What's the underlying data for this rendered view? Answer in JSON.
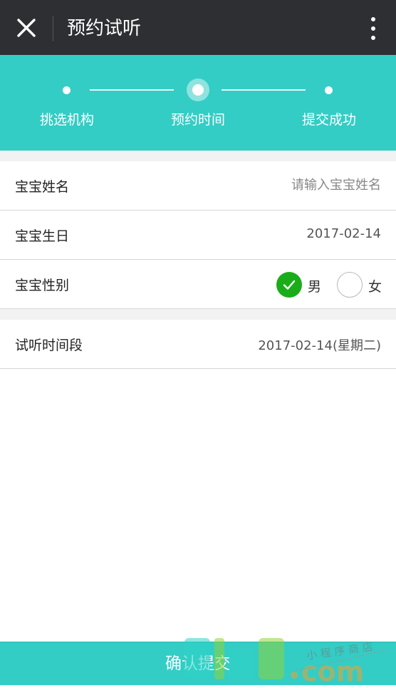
{
  "navbar": {
    "title": "预约试听",
    "close_icon": "close-icon",
    "more_icon": "more-vertical-icon",
    "background": "#2e2f33"
  },
  "stepper": {
    "background": "#33cdc5",
    "steps": [
      {
        "label": "挑选机构",
        "state": "done"
      },
      {
        "label": "预约时间",
        "state": "active"
      },
      {
        "label": "提交成功",
        "state": "pending"
      }
    ]
  },
  "form": {
    "baby_name": {
      "label": "宝宝姓名",
      "value": "",
      "placeholder": "请输入宝宝姓名"
    },
    "baby_birthday": {
      "label": "宝宝生日",
      "value": "2017-02-14"
    },
    "baby_gender": {
      "label": "宝宝性别",
      "options": [
        {
          "label": "男",
          "checked": true
        },
        {
          "label": "女",
          "checked": false
        }
      ],
      "checked_color": "#1aad19"
    },
    "trial_period": {
      "label": "试听时间段",
      "value": "2017-02-14(星期二)"
    }
  },
  "submit": {
    "label": "确认提交",
    "background": "#33cdc5"
  },
  "watermark": {
    "brand": "aiud.com",
    "tagline": "小程序商店"
  }
}
